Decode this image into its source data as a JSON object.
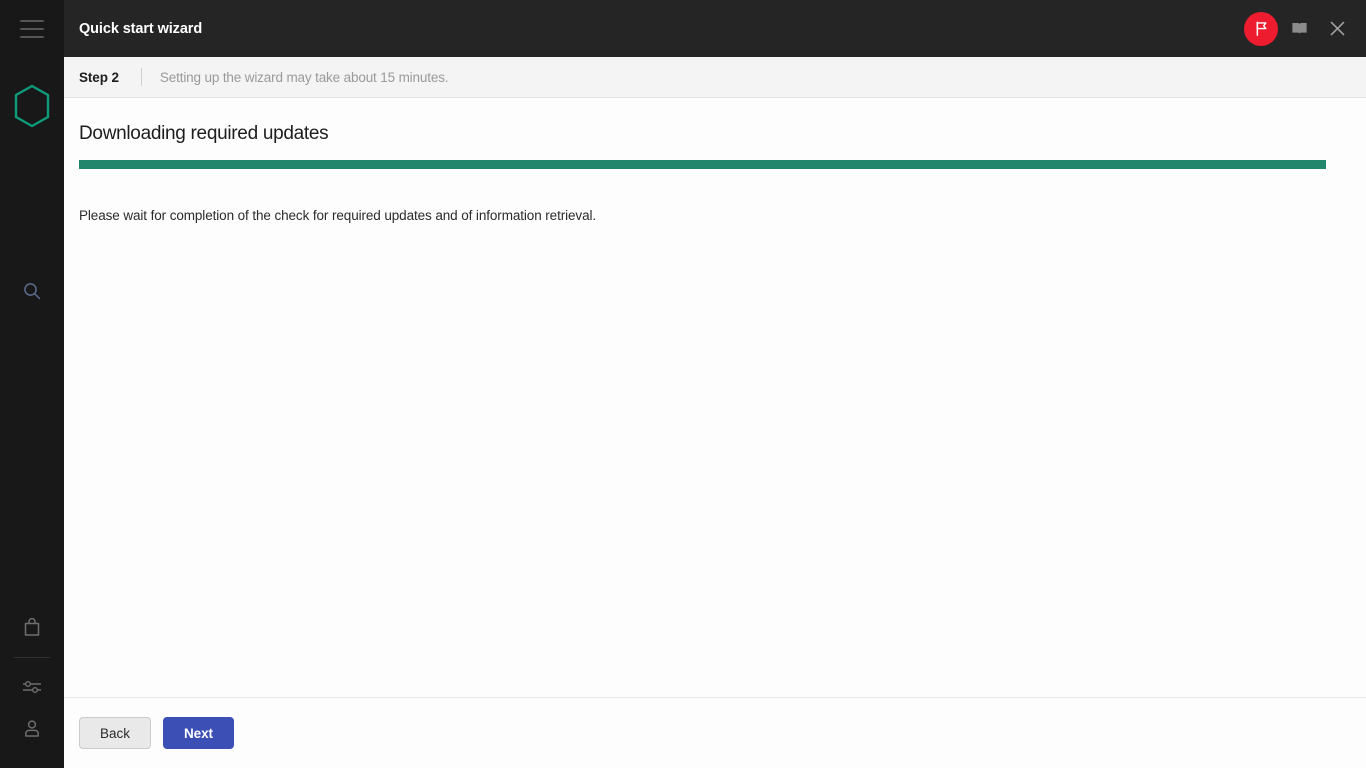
{
  "window": {
    "title": "Quick start wizard",
    "menu_icon": "hamburger-menu-icon",
    "flag_icon": "flag-icon",
    "help_icon": "book-icon",
    "close_icon": "close-icon",
    "flag_badge_color": "#ED1C2E",
    "titlebar_color": "#252525"
  },
  "sidebar": {
    "logo_icon": "hexagon-logo-icon",
    "logo_color": "#0E9B7C",
    "items": [
      {
        "icon": "search-icon",
        "label": "Search"
      },
      {
        "icon": "bag-icon",
        "label": "Products"
      },
      {
        "icon": "sliders-icon",
        "label": "Settings"
      },
      {
        "icon": "user-icon",
        "label": "Account"
      }
    ]
  },
  "stepbar": {
    "step_label": "Step 2",
    "hint": "Setting up the wizard may take about 15 minutes."
  },
  "content": {
    "title": "Downloading required updates",
    "progress_percent": 100,
    "progress_color": "#21866B",
    "message": "Please wait for completion of the check for required updates and of information retrieval."
  },
  "footer": {
    "back_label": "Back",
    "next_label": "Next",
    "next_color": "#3B4FB5"
  }
}
